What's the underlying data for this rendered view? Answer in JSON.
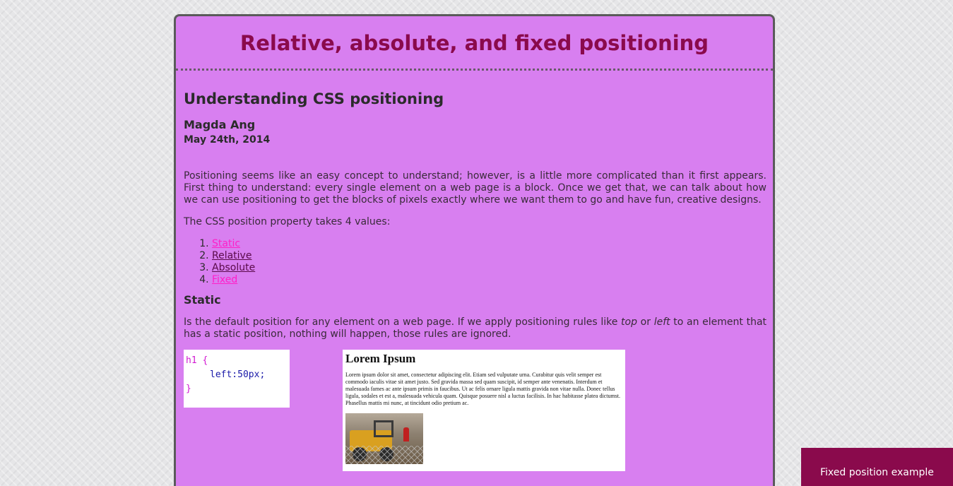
{
  "header": {
    "title": "Relative, absolute, and fixed positioning"
  },
  "article": {
    "title": "Understanding CSS positioning",
    "author": "Magda Ang",
    "date": "May 24th, 2014",
    "intro": "Positioning seems like an easy concept to understand; however, is a little more complicated than it first appears. First thing to understand: every single element on a web page is a block. Once we get that, we can talk about how we can use positioning to get the blocks of pixels exactly where we want them to go and have fun, creative designs.",
    "values_intro": "The CSS position property takes 4 values:",
    "positions": [
      {
        "label": "Static",
        "color": "#ff1fc8"
      },
      {
        "label": "Relative",
        "color": "#5a0a4a"
      },
      {
        "label": "Absolute",
        "color": "#5a0a4a"
      },
      {
        "label": "Fixed",
        "color": "#ff1fc8"
      }
    ],
    "static_section": {
      "title": "Static",
      "desc_before": "Is the default position for any element on a web page. If we apply positioning rules like ",
      "desc_top": "top",
      "desc_or": " or ",
      "desc_left": "left",
      "desc_after": " to an element that has a static position, nothing will happen, those rules are ignored."
    },
    "code_example": {
      "selector_line": "h1 {",
      "property_line": "left:50px;",
      "closing_line": "}"
    },
    "lorem_example": {
      "title": "Lorem Ipsum",
      "text": "Lorem ipsum dolor sit amet, consectetur adipiscing elit. Etiam sed vulputate urna. Curabitur quis velit semper est commodo iaculis vitae sit amet justo. Sed gravida massa sed quam suscipit, id semper ante venenatis. Interdum et malesuada fames ac ante ipsum primis in faucibus. Ut ac felis ornare ligula mattis gravida non vitae nulla. Donec tellus ligula, sodales et est a, malesuada vehicula quam. Quisque posuere nisl a luctus facilisis. In hac habitasse platea dictumst. Phasellus mattis mi nunc, at tincidunt odio pretium ac."
    }
  },
  "fixed_banner": {
    "label": "Fixed position example"
  },
  "colors": {
    "page_background": "#d87ff0",
    "title_color": "#8a0a4c",
    "banner_background": "#8a0a4c",
    "link_pink": "#ff1fc8",
    "link_dark": "#5a0a4a"
  }
}
